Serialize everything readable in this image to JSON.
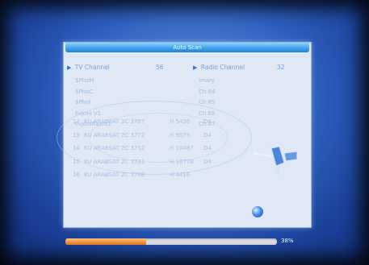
{
  "dialog": {
    "title": "Auto Scan"
  },
  "tv": {
    "label": "TV Channel",
    "count": "56"
  },
  "radio": {
    "label": "Radio Channel",
    "count": "32"
  },
  "tv_channels": [
    "$PhoM",
    "$PhoC",
    "$Phol",
    "Fujoni V1",
    "FujoniRadio1"
  ],
  "radio_channels": [
    "Imary",
    "Ch 84",
    "Ch 85",
    "Ch 86",
    "Ch 87"
  ],
  "transponders": [
    {
      "num": "17",
      "sat": "KU ARABSAT 2C 3787",
      "freq": "H 5436",
      "sym": "D4"
    },
    {
      "num": "13",
      "sat": "KU ARABSAT 2C 3772",
      "freq": "H 9073",
      "sym": "D4"
    },
    {
      "num": "14",
      "sat": "KU ARABSAT 2C 3752",
      "freq": "H 10487",
      "sym": "D4"
    },
    {
      "num": "15",
      "sat": "KU ARABSAT 2C 3731",
      "freq": "H 10778",
      "sym": "D4"
    },
    {
      "num": "16",
      "sat": "KU ARABSAT 2C 3708",
      "freq": "H 4416",
      "sym": ""
    }
  ],
  "progress": {
    "percent": 38,
    "label": "38%"
  },
  "colors": {
    "accent": "#2a77d8",
    "progress": "#f07a20",
    "title_bar": "#3fa2ea"
  },
  "icons": {
    "satellite": "satellite-icon",
    "globe": "globe-icon",
    "tv_marker": "play-triangle-icon",
    "radio_marker": "play-triangle-icon"
  }
}
